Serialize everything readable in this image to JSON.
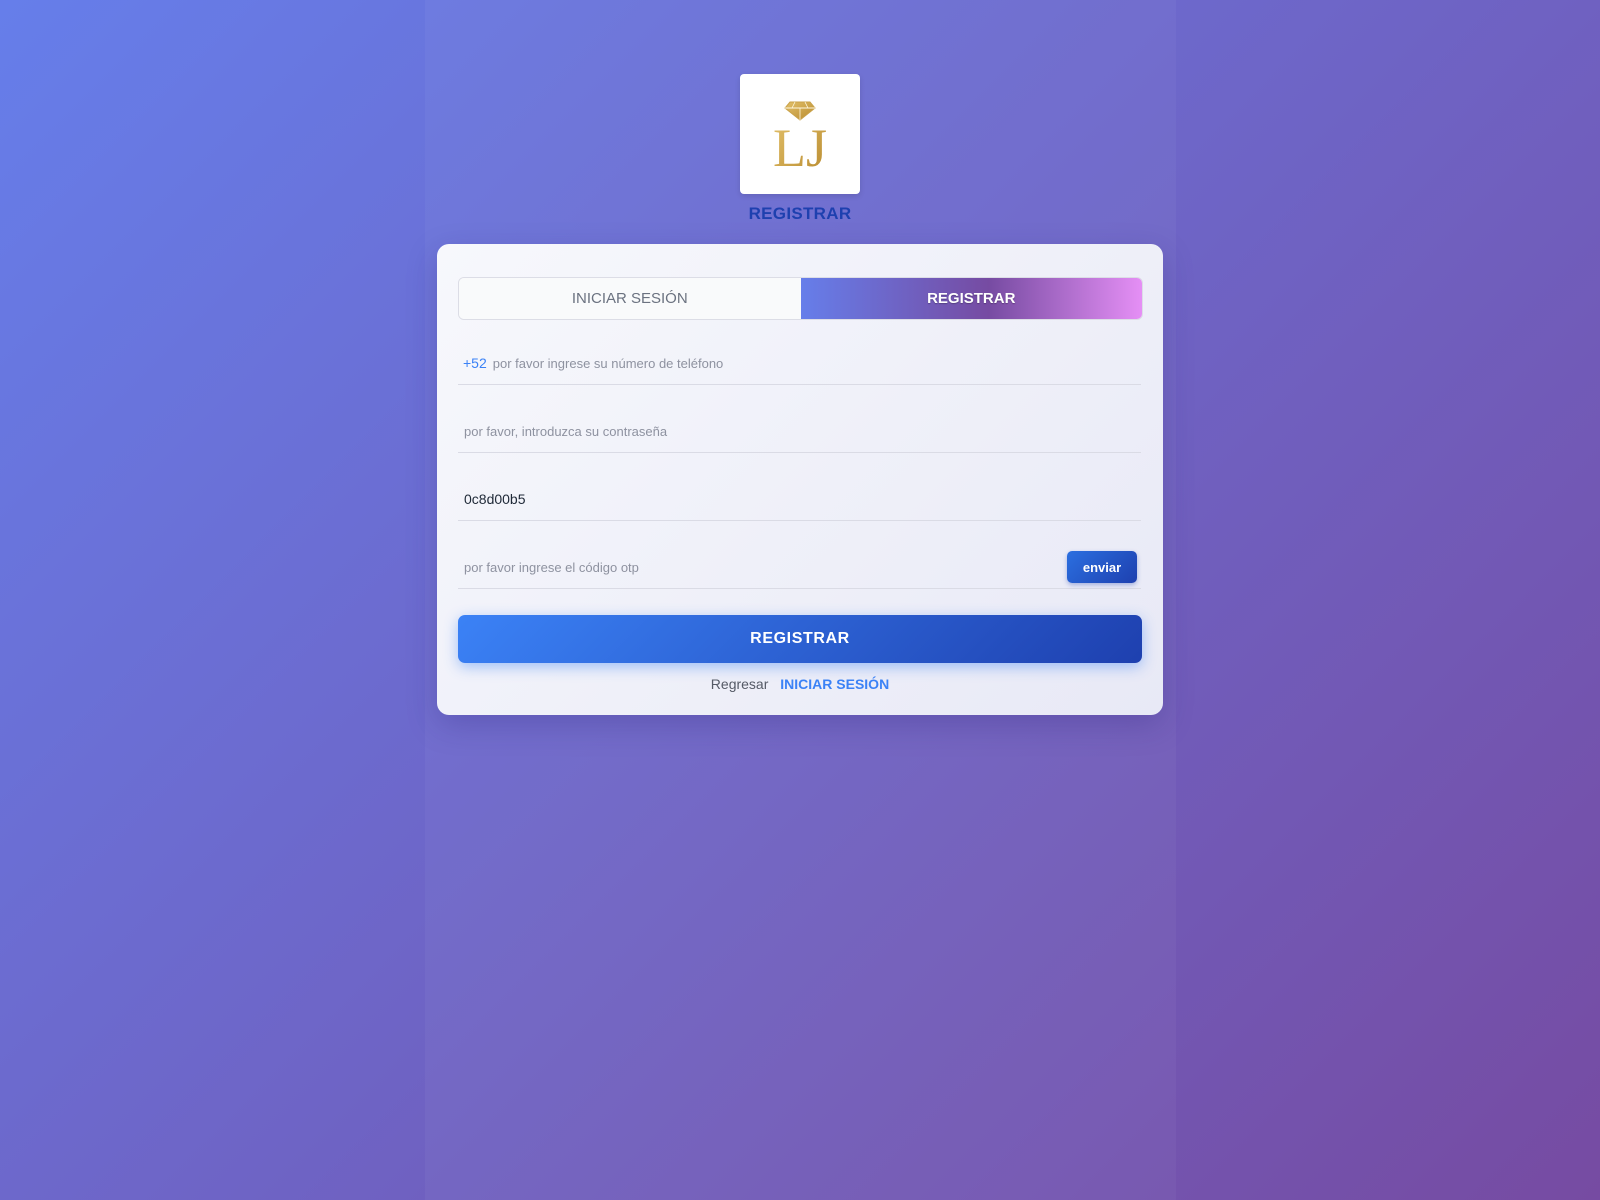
{
  "logo": {
    "monogram": "LJ",
    "accent_color": "#c9a24a",
    "icon": "diamond-icon"
  },
  "page_title": "REGISTRAR",
  "tabs": [
    {
      "label": "INICIAR SESIÓN",
      "active": false
    },
    {
      "label": "REGISTRAR",
      "active": true
    }
  ],
  "form": {
    "phone": {
      "prefix": "+52",
      "placeholder": "por favor ingrese su número de teléfono",
      "value": ""
    },
    "password": {
      "placeholder": "por favor, introduzca su contraseña",
      "value": ""
    },
    "invite_code": {
      "value": "0c8d00b5"
    },
    "otp": {
      "placeholder": "por favor ingrese el código otp",
      "value": "",
      "send_label": "enviar"
    },
    "submit_label": "REGISTRAR"
  },
  "footer": {
    "text": "Regresar",
    "link_label": "INICIAR SESIÓN"
  },
  "colors": {
    "background_start": "#667eea",
    "background_end": "#764ba2",
    "primary": "#3b82f6",
    "primary_dark": "#1e40af",
    "tab_gradient_end": "#e58ff5"
  }
}
